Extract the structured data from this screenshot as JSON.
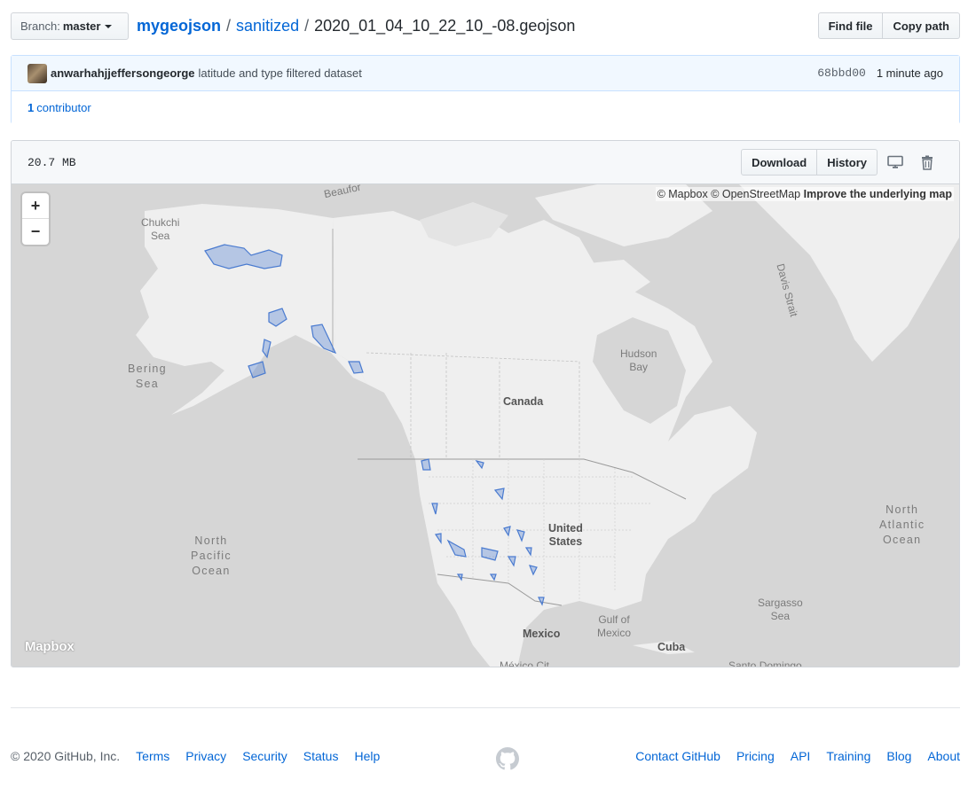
{
  "branch": {
    "label": "Branch:",
    "value": "master"
  },
  "breadcrumb": {
    "repo": "mygeojson",
    "sep1": "/",
    "dir": "sanitized",
    "sep2": "/",
    "file": "2020_01_04_10_22_10_-08.geojson"
  },
  "top_actions": {
    "find_file": "Find file",
    "copy_path": "Copy path"
  },
  "commit": {
    "author": "anwarhahjjeffersongeorge",
    "message": "latitude and type filtered dataset",
    "sha": "68bbd00",
    "time": "1 minute ago",
    "contributors_count": "1",
    "contributors_label": "contributor"
  },
  "file": {
    "size": "20.7 MB",
    "download": "Download",
    "history": "History",
    "icons": {
      "desktop": "desktop-icon",
      "delete": "trash-icon"
    }
  },
  "map": {
    "attribution_prefix": "© Mapbox © OpenStreetMap",
    "attribution_link": "Improve the underlying map",
    "zoom_in": "+",
    "zoom_out": "−",
    "logo": "Mapbox",
    "labels": {
      "chukchi": "Chukchi\nSea",
      "beaufort": "Beaufor",
      "bering": "Bering\nSea",
      "davis": "Davis Strait",
      "hudson": "Hudson\nBay",
      "canada": "Canada",
      "us": "United\nStates",
      "north_pacific": "North\nPacific\nOcean",
      "north_atlantic": "North\nAtlantic\nOcean",
      "sargasso": "Sargasso\nSea",
      "gulf_mexico": "Gulf of\nMexico",
      "mexico": "Mexico",
      "cuba": "Cuba",
      "mexico_city": "México Cit",
      "santo_domingo": "Santo Domingo"
    },
    "colors": {
      "water": "#d6d6d6",
      "land": "#efefef",
      "feature": "#4a7bd0"
    }
  },
  "footer": {
    "copyright": "© 2020 GitHub, Inc.",
    "left_links": [
      "Terms",
      "Privacy",
      "Security",
      "Status",
      "Help"
    ],
    "right_links": [
      "Contact GitHub",
      "Pricing",
      "API",
      "Training",
      "Blog",
      "About"
    ],
    "logo_icon": "github-mark-icon"
  }
}
